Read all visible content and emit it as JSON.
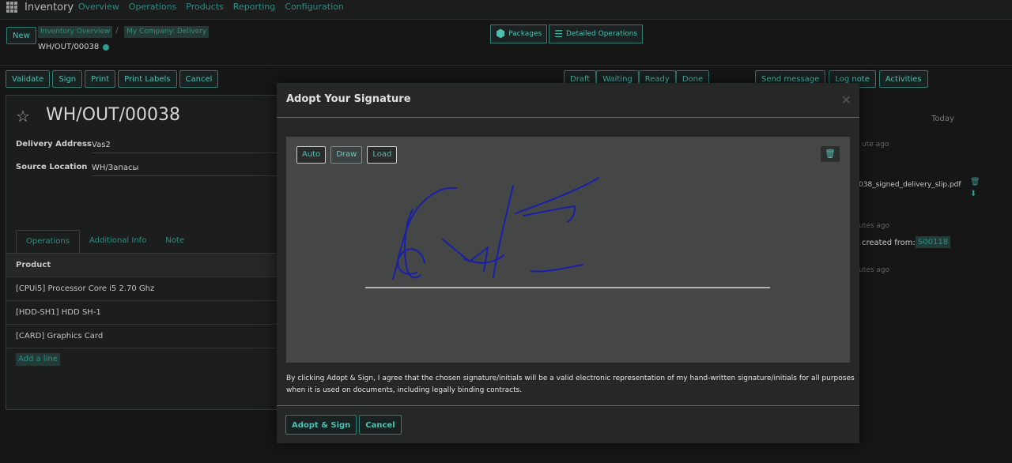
{
  "topbar": {
    "app_title": "Inventory",
    "nav": [
      "Overview",
      "Operations",
      "Products",
      "Reporting",
      "Configuration"
    ]
  },
  "control": {
    "new_label": "New",
    "breadcrumb": [
      "Inventory Overview",
      "My Company: Delivery"
    ],
    "record_name": "WH/OUT/00038",
    "smart_buttons": [
      "Packages",
      "Detailed Operations"
    ]
  },
  "actions": [
    "Validate",
    "Sign",
    "Print",
    "Print Labels",
    "Cancel"
  ],
  "status": [
    "Draft",
    "Waiting",
    "Ready",
    "Done"
  ],
  "chatter": {
    "buttons": [
      "Send message",
      "Log note",
      "Activities"
    ],
    "today": "Today",
    "time1": "ute ago",
    "attachment": "038_signed_delivery_slip.pdf",
    "time2": "utes ago",
    "created_text": "created from:",
    "created_ref": "S00118",
    "time3": "utes ago"
  },
  "form": {
    "title": "WH/OUT/00038",
    "delivery_address_label": "Delivery Address",
    "delivery_address": "Vas2",
    "source_location_label": "Source Location",
    "source_location": "WH/Запасы",
    "tabs": [
      "Operations",
      "Additional Info",
      "Note"
    ],
    "table_header": "Product",
    "rows": [
      "[CPUi5] Processor Core i5 2.70 Ghz",
      "[HDD-SH1] HDD SH-1",
      "[CARD] Graphics Card"
    ],
    "add_line": "Add a line"
  },
  "modal": {
    "title": "Adopt Your Signature",
    "tools": [
      "Auto",
      "Draw",
      "Load"
    ],
    "legal_text": "By clicking Adopt & Sign, I agree that the chosen signature/initials will be a valid electronic representation of my hand-written signature/initials for all purposes when it is used on documents, including legally binding contracts.",
    "adopt_label": "Adopt & Sign",
    "cancel_label": "Cancel"
  },
  "colors": {
    "accent": "#4fbfb1",
    "ink": "#1a1fa8",
    "background": "#161616"
  }
}
